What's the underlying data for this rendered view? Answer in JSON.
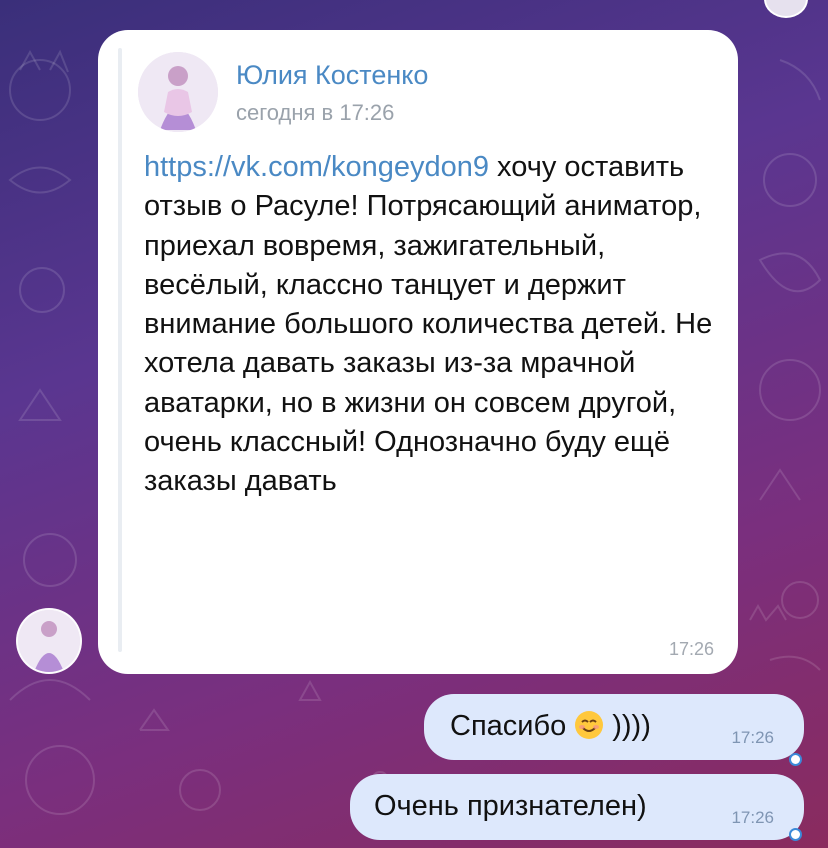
{
  "post": {
    "author": "Юлия Костенко",
    "date": "сегодня в 17:26",
    "link": "https://vk.com/kongeydon9",
    "text_after_link": "хочу оставить отзыв о Расуле! Потрясающий аниматор, приехал вовремя, зажигательный, весёлый, классно танцует и держит внимание большого количества детей. Не хотела давать заказы из-за мрачной аватарки, но в жизни он совсем другой, очень классный! Однозначно буду ещё заказы давать",
    "time": "17:26"
  },
  "outgoing": [
    {
      "text_before_emoji": "Спасибо",
      "emoji": "smiling-face-emoji",
      "text_after_emoji": "))))",
      "time": "17:26"
    },
    {
      "text": "Очень признателен)",
      "time": "17:26"
    }
  ],
  "colors": {
    "incoming_bubble": "#ffffff",
    "outgoing_bubble": "#dde8fc",
    "link": "#4a89c4",
    "read_status": "#3b8ad9"
  }
}
